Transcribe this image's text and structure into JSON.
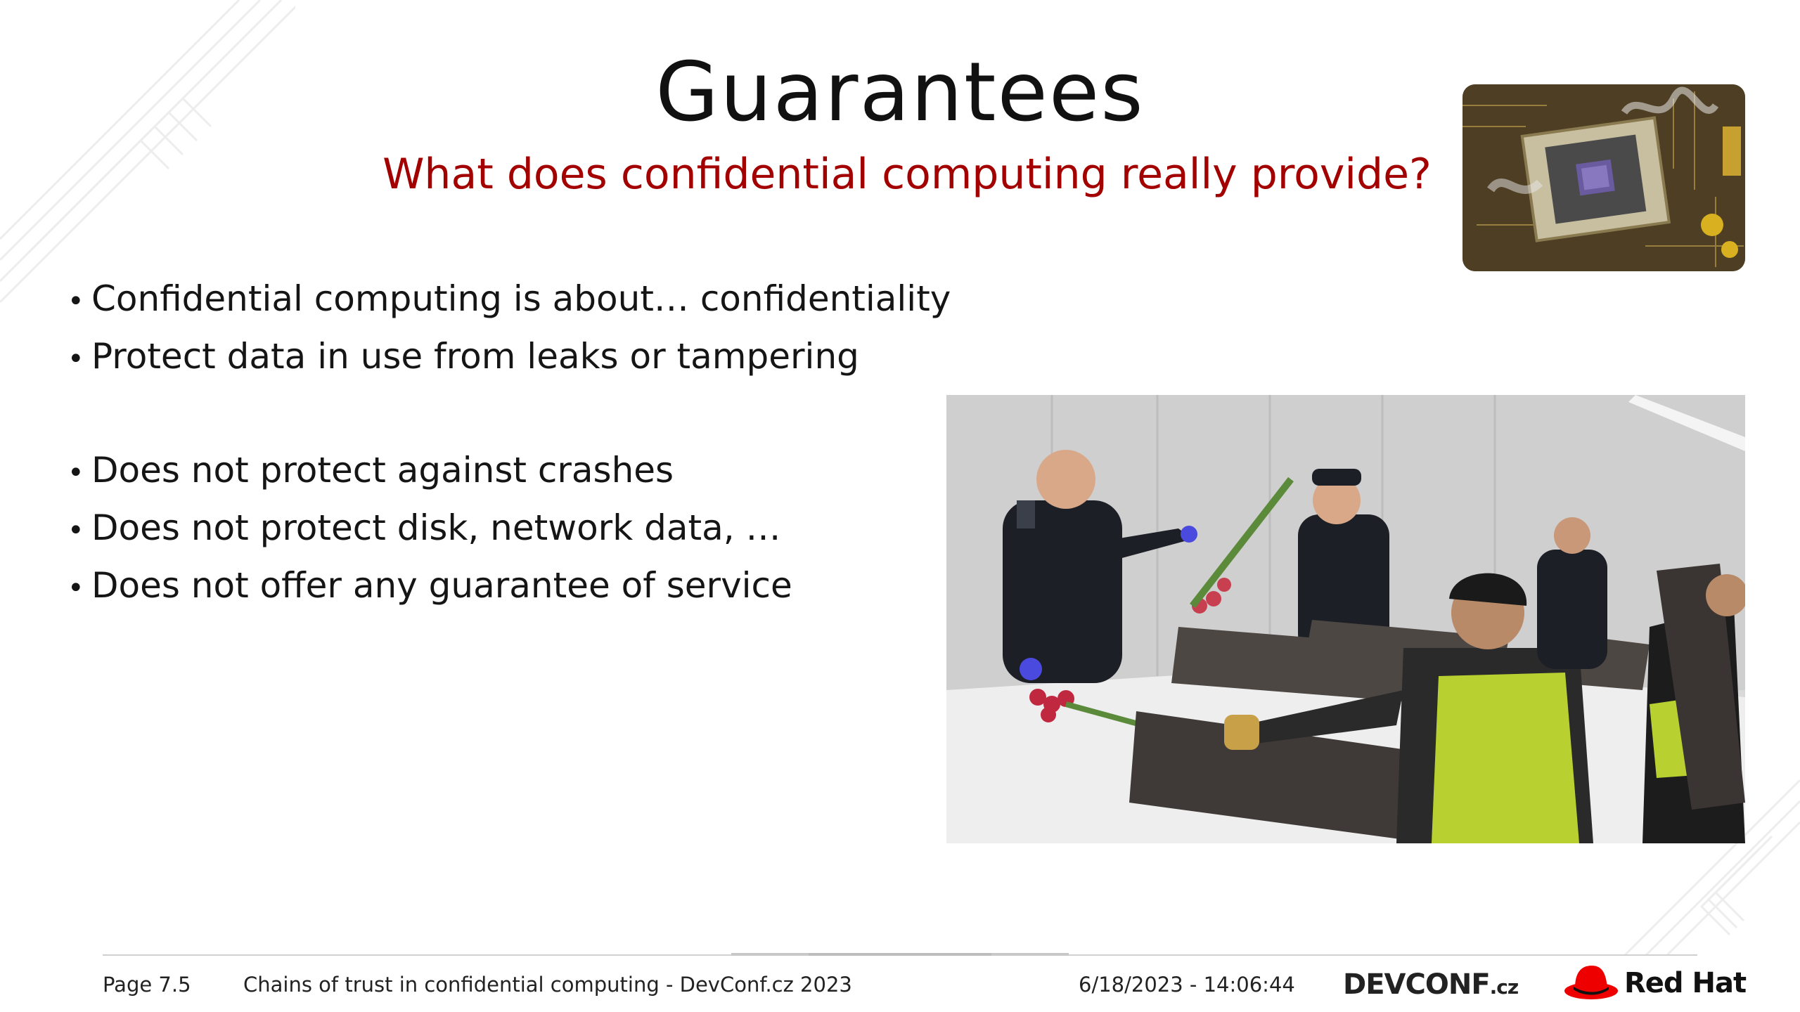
{
  "slide": {
    "title": "Guarantees",
    "subtitle": "What does confidential computing really provide?",
    "bullets_group1": [
      "Confidential computing is about… confidentiality",
      "Protect data in use from leaks or tampering"
    ],
    "bullets_group2": [
      "Does not protect against crashes",
      "Does not protect disk, network data, …",
      "Does not offer any guarantee of service"
    ],
    "bullet_glyph": "•"
  },
  "images": {
    "cpu_photo": "smoking-cpu-socket-photo",
    "customs_photo": "customs-officers-inspecting-flower-boxes-photo"
  },
  "footer": {
    "page": "Page 7.5",
    "presentation": "Chains of trust in confidential computing - DevConf.cz 2023",
    "datetime": "6/18/2023 - 14:06:44",
    "devconf_logo_main": "DEVCONF",
    "devconf_logo_suffix": ".cz",
    "redhat_logo": "Red Hat"
  },
  "colors": {
    "subtitle": "#a30000",
    "redhat_red": "#ee0000"
  }
}
